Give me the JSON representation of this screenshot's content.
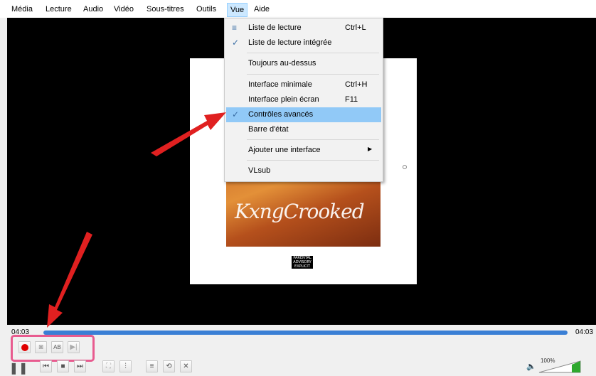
{
  "menu": {
    "items": [
      "Média",
      "Lecture",
      "Audio",
      "Vidéo",
      "Sous-titres",
      "Outils",
      "Vue",
      "Aide"
    ],
    "active": "Vue"
  },
  "view_menu": {
    "items": [
      {
        "label": "Liste de lecture",
        "shortcut": "Ctrl+L",
        "icon": "playlist-icon"
      },
      {
        "label": "Liste de lecture intégrée",
        "shortcut": "",
        "icon": "check-icon",
        "checked": true
      },
      {
        "label": "Toujours au-dessus",
        "shortcut": ""
      },
      {
        "label": "Interface minimale",
        "shortcut": "Ctrl+H"
      },
      {
        "label": "Interface plein écran",
        "shortcut": "F11"
      },
      {
        "label": "Contrôles avancés",
        "shortcut": "",
        "checked": true,
        "highlighted": true
      },
      {
        "label": "Barre d'état",
        "shortcut": ""
      },
      {
        "label": "Ajouter une interface",
        "shortcut": "",
        "submenu": true
      },
      {
        "label": "VLsub",
        "shortcut": ""
      }
    ]
  },
  "album_art": {
    "signature": "KxngCrooked",
    "advisory": "PARENTAL ADVISORY EXPLICIT CONTENT"
  },
  "seek": {
    "elapsed": "04:03",
    "total": "04:03",
    "progress": 1.0
  },
  "volume": {
    "level": "100%"
  },
  "colors": {
    "highlight": "#91c9f7",
    "seek": "#3a7fd5",
    "record": "#e00000",
    "callout": "#e85b8f",
    "arrow": "#e02020",
    "volume": "#2ea82e"
  }
}
